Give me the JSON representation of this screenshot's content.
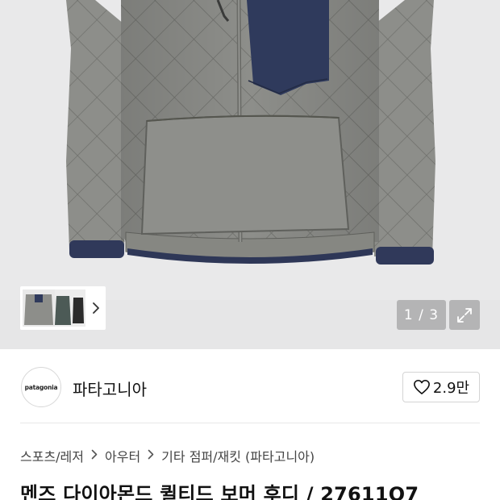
{
  "gallery": {
    "pager_text": "1 / 3",
    "expand_icon": "expand-arrows-icon",
    "thumb_next_icon": "chevron-right-icon",
    "colors": {
      "jacket": "#8c8d89",
      "jacket_dark": "#6f706c",
      "chest_panel": "#2f3a5c",
      "background": "#e9e9ea"
    }
  },
  "brand": {
    "logo_text": "patagonia",
    "name": "파타고니아",
    "like_icon": "heart-outline-icon",
    "like_count": "2.9만"
  },
  "breadcrumb": {
    "items": [
      "스포츠/레저",
      "아우터",
      "기타 점퍼/재킷 (파타고니아)"
    ],
    "separator_icon": "chevron-right-icon"
  },
  "product": {
    "title": "멘즈 다이아몬드 퀼티드 보머 후디 / 27611Q7"
  }
}
